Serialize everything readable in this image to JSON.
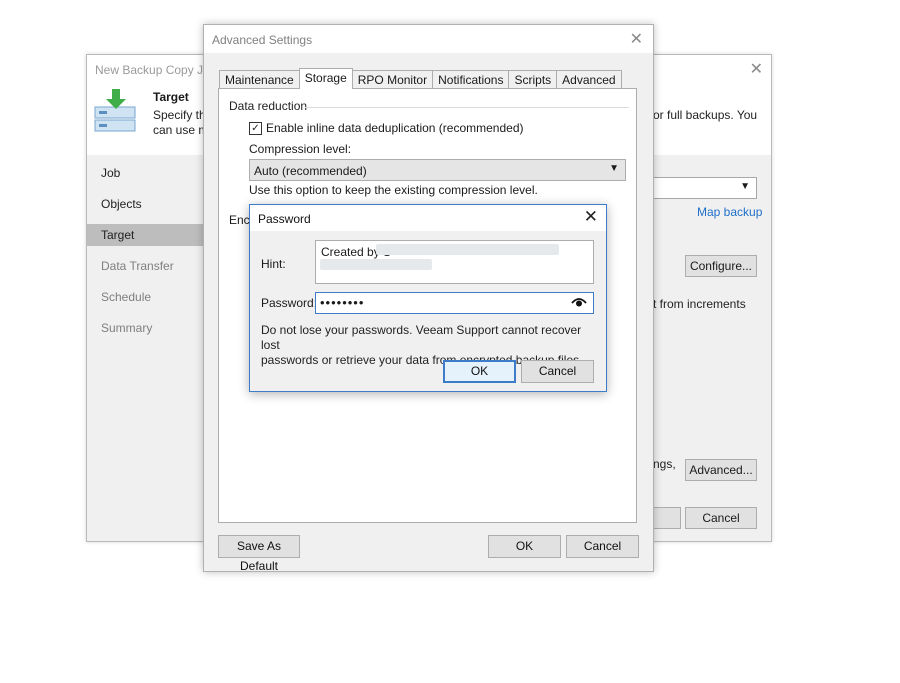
{
  "wizard": {
    "title": "New Backup Copy Job",
    "step_title": "Target",
    "step_desc_line1": "Specify the",
    "step_desc_line2": "can use ma",
    "step_desc_right": "or full backups. You",
    "nav": [
      {
        "label": "Job"
      },
      {
        "label": "Objects"
      },
      {
        "label": "Target"
      },
      {
        "label": "Data Transfer"
      },
      {
        "label": "Schedule"
      },
      {
        "label": "Summary"
      }
    ],
    "map_backup_link": "Map backup",
    "configure_button": "Configure...",
    "increments_text": "t from increments",
    "settings_text": "ngs,",
    "advanced_button": "Advanced...",
    "cancel_button": "Cancel"
  },
  "advanced": {
    "title": "Advanced Settings",
    "tabs": [
      "Maintenance",
      "Storage",
      "RPO Monitor",
      "Notifications",
      "Scripts",
      "Advanced"
    ],
    "selected_tab": "Storage",
    "data_reduction_label": "Data reduction",
    "dedup_label": "Enable inline data deduplication (recommended)",
    "compression_label": "Compression level:",
    "compression_value": "Auto (recommended)",
    "compression_help": "Use this option to keep the existing compression level.",
    "encryption_label_partial": "Encr",
    "save_default_button": "Save As Default",
    "ok_button": "OK",
    "cancel_button": "Cancel"
  },
  "password_dialog": {
    "title": "Password",
    "hint_label": "Hint:",
    "hint_value": "Created by S",
    "password_label": "Password:",
    "password_value": "••••••••",
    "warning_line1": "Do not lose your passwords. Veeam Support cannot recover lost",
    "warning_line2": "passwords or retrieve your data from encrypted backup files.",
    "ok_button": "OK",
    "cancel_button": "Cancel"
  },
  "colors": {
    "accent": "#3e7bc9",
    "link": "#1e6fc9",
    "nav_active": "#bdbdbd"
  },
  "icons": [
    "close-icon",
    "backup-target-icon",
    "chevron-down-icon",
    "checkbox-checked-icon",
    "eye-icon"
  ]
}
